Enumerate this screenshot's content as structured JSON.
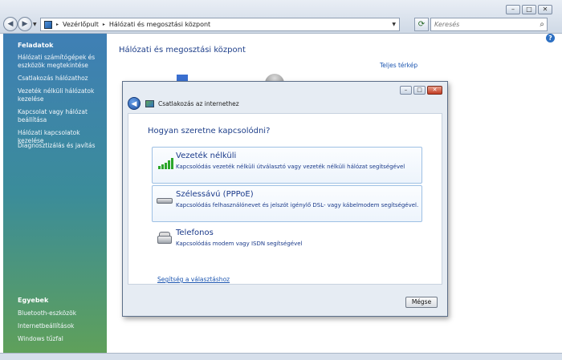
{
  "window": {
    "controls": [
      "–",
      "□",
      "✕"
    ]
  },
  "address_bar": {
    "breadcrumb": [
      "Vezérlőpult",
      "Hálózati és megosztási központ"
    ],
    "separator": "▸"
  },
  "search": {
    "placeholder": "Keresés"
  },
  "sidebar": {
    "tasks_header": "Feladatok",
    "tasks": [
      "Hálózati számítógépek és eszközök megtekintése",
      "Csatlakozás hálózathoz",
      "Vezeték nélküli hálózatok kezelése",
      "Kapcsolat vagy hálózat beállítása",
      "Hálózati kapcsolatok kezelése",
      "Diagnosztizálás és javítás"
    ],
    "other_header": "Egyebek",
    "other": [
      "Bluetooth-eszközök",
      "Internetbeállítások",
      "Windows tűzfal"
    ]
  },
  "main": {
    "title": "Hálózati és megosztási központ",
    "full_map_link": "Teljes térkép"
  },
  "dialog": {
    "title": "Csatlakozás az internethez",
    "question": "Hogyan szeretne kapcsolódni?",
    "options": [
      {
        "title": "Vezeték nélküli",
        "desc": "Kapcsolódás vezeték nélküli útválasztó vagy vezeték nélküli hálózat segítségével",
        "icon": "wireless-signal-icon"
      },
      {
        "title": "Szélessávú (PPPoE)",
        "desc": "Kapcsolódás felhasználónevet és jelszót igénylő DSL- vagy kábelmodem segítségével.",
        "icon": "modem-icon"
      },
      {
        "title": "Telefonos",
        "desc": "Kapcsolódás modem vagy ISDN segítségével",
        "icon": "phone-icon"
      }
    ],
    "help_link": "Segítség a választáshoz",
    "cancel_label": "Mégse"
  },
  "colors": {
    "accent": "#1e3f8a",
    "link": "#1b55b0",
    "sidebar_top": "#3f7fb5",
    "sidebar_bottom": "#5fa05a"
  }
}
